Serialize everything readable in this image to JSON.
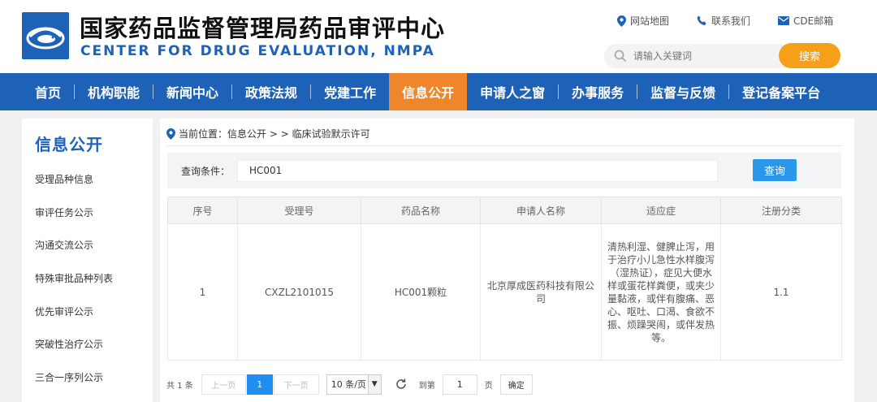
{
  "header": {
    "title_cn": "国家药品监督管理局药品审评中心",
    "title_en": "CENTER FOR DRUG EVALUATION, NMPA",
    "links": {
      "sitemap": "网站地图",
      "contact": "联系我们",
      "mail": "CDE邮箱"
    },
    "search": {
      "placeholder": "请输入关键词",
      "button": "搜索"
    }
  },
  "nav": {
    "items": [
      "首页",
      "机构职能",
      "新闻中心",
      "政策法规",
      "党建工作",
      "信息公开",
      "申请人之窗",
      "办事服务",
      "监督与反馈",
      "登记备案平台"
    ],
    "active": "信息公开"
  },
  "sidebar": {
    "title": "信息公开",
    "items": [
      "受理品种信息",
      "审评任务公示",
      "沟通交流公示",
      "特殊审批品种列表",
      "优先审评公示",
      "突破性治疗公示",
      "三合一序列公示"
    ]
  },
  "breadcrumb": {
    "label": "当前位置：",
    "parent": "信息公开",
    "sep": " > > ",
    "current": "临床试验默示许可"
  },
  "query": {
    "label": "查询条件：",
    "value": "HC001",
    "button": "查询"
  },
  "table": {
    "headers": [
      "序号",
      "受理号",
      "药品名称",
      "申请人名称",
      "适应症",
      "注册分类"
    ],
    "rows": [
      {
        "no": "1",
        "accept_no": "CXZL2101015",
        "drug": "HC001颗粒",
        "applicant": "北京厚成医药科技有限公司",
        "indication": "清热利湿、健脾止泻，用于治疗小儿急性水样腹泻（湿热证），症见大便水样或蛋花样粪便，或夹少量黏液，或伴有腹痛、恶心、呕吐、口渴、食欲不振、烦躁哭闹，或伴发热等。",
        "category": "1.1"
      }
    ]
  },
  "pager": {
    "total": "共 1 条",
    "prev": "上一页",
    "current": "1",
    "next": "下一页",
    "page_size": "10 条/页",
    "goto_label": "到第",
    "goto_value": "1",
    "page_label": "页",
    "ok": "确定"
  },
  "colors": {
    "brand_blue": "#1e62b8",
    "active_orange": "#f0862b",
    "search_orange": "#f6a01a",
    "button_blue": "#2c96e8"
  }
}
